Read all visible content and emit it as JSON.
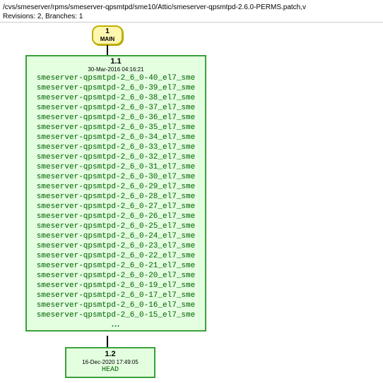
{
  "header": {
    "path": "/cvs/smeserver/rpms/smeserver-qpsmtpd/sme10/Attic/smeserver-qpsmtpd-2.6.0-PERMS.patch,v",
    "info": "Revisions: 2, Branches: 1"
  },
  "branch": {
    "num": "1",
    "name": "MAIN"
  },
  "rev11": {
    "title": "1.1",
    "date": "30-Mar-2016 04:16:21",
    "tags": [
      "smeserver-qpsmtpd-2_6_0-40_el7_sme",
      "smeserver-qpsmtpd-2_6_0-39_el7_sme",
      "smeserver-qpsmtpd-2_6_0-38_el7_sme",
      "smeserver-qpsmtpd-2_6_0-37_el7_sme",
      "smeserver-qpsmtpd-2_6_0-36_el7_sme",
      "smeserver-qpsmtpd-2_6_0-35_el7_sme",
      "smeserver-qpsmtpd-2_6_0-34_el7_sme",
      "smeserver-qpsmtpd-2_6_0-33_el7_sme",
      "smeserver-qpsmtpd-2_6_0-32_el7_sme",
      "smeserver-qpsmtpd-2_6_0-31_el7_sme",
      "smeserver-qpsmtpd-2_6_0-30_el7_sme",
      "smeserver-qpsmtpd-2_6_0-29_el7_sme",
      "smeserver-qpsmtpd-2_6_0-28_el7_sme",
      "smeserver-qpsmtpd-2_6_0-27_el7_sme",
      "smeserver-qpsmtpd-2_6_0-26_el7_sme",
      "smeserver-qpsmtpd-2_6_0-25_el7_sme",
      "smeserver-qpsmtpd-2_6_0-24_el7_sme",
      "smeserver-qpsmtpd-2_6_0-23_el7_sme",
      "smeserver-qpsmtpd-2_6_0-22_el7_sme",
      "smeserver-qpsmtpd-2_6_0-21_el7_sme",
      "smeserver-qpsmtpd-2_6_0-20_el7_sme",
      "smeserver-qpsmtpd-2_6_0-19_el7_sme",
      "smeserver-qpsmtpd-2_6_0-17_el7_sme",
      "smeserver-qpsmtpd-2_6_0-16_el7_sme",
      "smeserver-qpsmtpd-2_6_0-15_el7_sme"
    ],
    "ellipsis": "..."
  },
  "rev12": {
    "title": "1.2",
    "date": "16-Dec-2020 17:49:05",
    "head": "HEAD"
  }
}
